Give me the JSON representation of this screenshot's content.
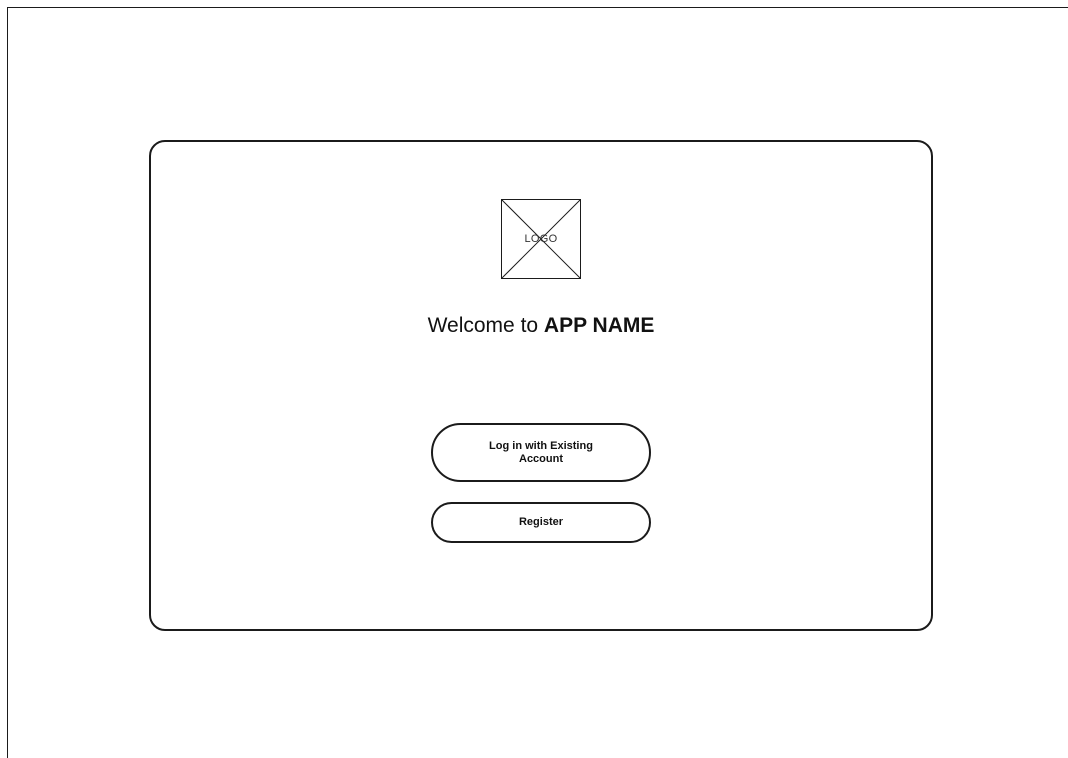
{
  "logo": {
    "text": "LOGO"
  },
  "welcome": {
    "prefix": "Welcome to ",
    "app_name": "APP NAME"
  },
  "actions": {
    "login_label": "Log in with Existing Account",
    "register_label": "Register"
  },
  "colors": {
    "stroke": "#1b1b1b",
    "background": "#ffffff",
    "text": "#111111"
  }
}
